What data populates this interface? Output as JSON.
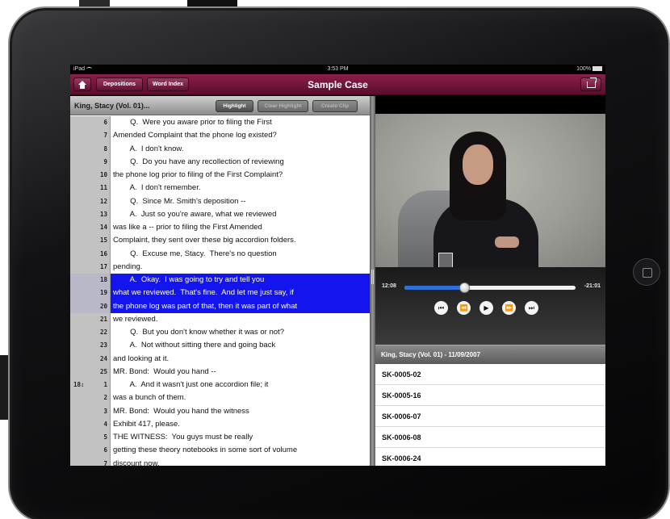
{
  "status_bar": {
    "carrier": "iPad",
    "time": "3:53 PM",
    "battery": "100%"
  },
  "nav": {
    "depositions_label": "Depositions",
    "word_index_label": "Word Index",
    "title": "Sample Case"
  },
  "toolbar": {
    "witness": "King, Stacy (Vol. 01)...",
    "highlight": "Highlight",
    "clear_highlight": "Clear Highlight",
    "create_clip": "Create Clip"
  },
  "transcript": [
    {
      "page": "",
      "num": "6",
      "text": "        Q.  Were you aware prior to filing the First",
      "hl": false
    },
    {
      "page": "",
      "num": "7",
      "text": "Amended Complaint that the phone log existed?",
      "hl": false
    },
    {
      "page": "",
      "num": "8",
      "text": "        A.  I don't know.",
      "hl": false
    },
    {
      "page": "",
      "num": "9",
      "text": "        Q.  Do you have any recollection of reviewing",
      "hl": false
    },
    {
      "page": "",
      "num": "10",
      "text": "the phone log prior to filing of the First Complaint?",
      "hl": false
    },
    {
      "page": "",
      "num": "11",
      "text": "        A.  I don't remember.",
      "hl": false
    },
    {
      "page": "",
      "num": "12",
      "text": "        Q.  Since Mr. Smith's deposition --",
      "hl": false
    },
    {
      "page": "",
      "num": "13",
      "text": "        A.  Just so you're aware, what we reviewed",
      "hl": false
    },
    {
      "page": "",
      "num": "14",
      "text": "was like a -- prior to filing the First Amended",
      "hl": false
    },
    {
      "page": "",
      "num": "15",
      "text": "Complaint, they sent over these big accordion folders.",
      "hl": false
    },
    {
      "page": "",
      "num": "16",
      "text": "        Q.  Excuse me, Stacy.  There's no question",
      "hl": false
    },
    {
      "page": "",
      "num": "17",
      "text": "pending.",
      "hl": false
    },
    {
      "page": "",
      "num": "18",
      "text": "        A.  Okay.  I was going to try and tell you",
      "hl": true
    },
    {
      "page": "",
      "num": "19",
      "text": "what we reviewed.  That's fine.  And let me just say, if",
      "hl": true
    },
    {
      "page": "",
      "num": "20",
      "text": "the phone log was part of that, then it was part of what",
      "hl": true
    },
    {
      "page": "",
      "num": "21",
      "text": "we reviewed.",
      "hl": false
    },
    {
      "page": "",
      "num": "22",
      "text": "        Q.  But you don't know whether it was or not?",
      "hl": false
    },
    {
      "page": "",
      "num": "23",
      "text": "        A.  Not without sitting there and going back",
      "hl": false
    },
    {
      "page": "",
      "num": "24",
      "text": "and looking at it.",
      "hl": false
    },
    {
      "page": "",
      "num": "25",
      "text": "MR. Bond:  Would you hand --",
      "hl": false
    },
    {
      "page": "18:",
      "num": "1",
      "text": "        A.  And it wasn't just one accordion file; it",
      "hl": false
    },
    {
      "page": "",
      "num": "2",
      "text": "was a bunch of them.",
      "hl": false
    },
    {
      "page": "",
      "num": "3",
      "text": "MR. Bond:  Would you hand the witness",
      "hl": false
    },
    {
      "page": "",
      "num": "4",
      "text": "Exhibit 417, please.",
      "hl": false
    },
    {
      "page": "",
      "num": "5",
      "text": "THE WITNESS:  You guys must be really",
      "hl": false
    },
    {
      "page": "",
      "num": "6",
      "text": "getting these theory notebooks in some sort of volume",
      "hl": false
    },
    {
      "page": "",
      "num": "7",
      "text": "discount now.",
      "hl": false
    }
  ],
  "player": {
    "elapsed": "12:08",
    "remaining": "-21:01",
    "progress": 0.35
  },
  "controls": {
    "first": "⏮",
    "rewind": "⏪",
    "play": "▶",
    "forward": "⏩",
    "last": "⏭"
  },
  "exhibits": {
    "header": "King, Stacy (Vol. 01) - 11/09/2007",
    "items": [
      "SK-0005-02",
      "SK-0005-16",
      "SK-0006-07",
      "SK-0006-08",
      "SK-0006-24"
    ]
  },
  "colors": {
    "nav_bar": "#7a1840",
    "highlight": "#1414ee",
    "progress": "#2f6fd8"
  }
}
